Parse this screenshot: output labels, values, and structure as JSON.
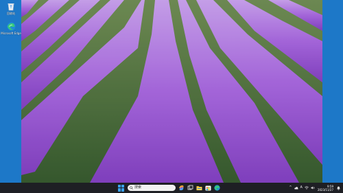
{
  "desktop": {
    "icons": [
      {
        "label": "回收站",
        "icon": "recycle-bin-icon"
      },
      {
        "label": "Microsoft Edge",
        "icon": "edge-icon"
      }
    ]
  },
  "taskbar": {
    "start_icon": "windows-start-icon",
    "search": {
      "placeholder": "搜索"
    },
    "pinned": [
      {
        "name": "copilot-icon"
      },
      {
        "name": "task-view-icon"
      },
      {
        "name": "file-explorer-icon"
      },
      {
        "name": "microsoft-store-icon"
      },
      {
        "name": "edge-icon"
      }
    ],
    "tray": {
      "chevron": "^",
      "input_method": "A",
      "clock": {
        "time": "9:59",
        "date": "2023/11/27"
      }
    }
  },
  "colors": {
    "desktop_bar": "#1d78c8",
    "taskbar": "#1e1f24",
    "lavender": "#9d5fd0",
    "grass": "#3e6b2c"
  }
}
